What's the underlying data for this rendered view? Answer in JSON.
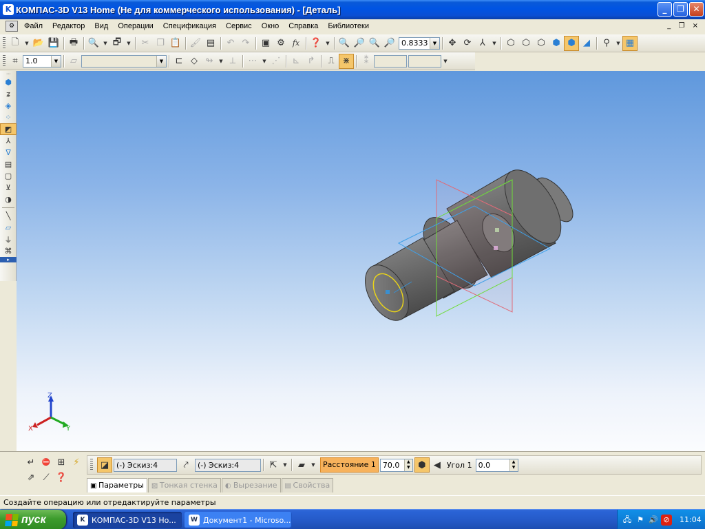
{
  "window": {
    "title": "КОМПАС-3D V13 Home (Не для коммерческого использования) - [Деталь]",
    "controls": [
      "_",
      "❐",
      "✕"
    ]
  },
  "menu": {
    "items": [
      "Файл",
      "Редактор",
      "Вид",
      "Операции",
      "Спецификация",
      "Сервис",
      "Окно",
      "Справка",
      "Библиотеки"
    ],
    "mdi_controls": "_ ❐ ×"
  },
  "toolbar": {
    "zoom_value": "0.8333",
    "step_value": "1.0"
  },
  "viewport": {
    "axes": {
      "z": "Z",
      "x": "X",
      "y": "Y"
    }
  },
  "params": {
    "sketch1": "(-) Эскиз:4",
    "sketch2": "(-) Эскиз:4",
    "distance_label": "Расстояние 1",
    "distance_value": "70.0",
    "angle_label": "Угол 1",
    "angle_value": "0.0"
  },
  "tabs": [
    {
      "label": "Параметры",
      "active": true
    },
    {
      "label": "Тонкая стенка",
      "active": false
    },
    {
      "label": "Вырезание",
      "active": false
    },
    {
      "label": "Свойства",
      "active": false
    }
  ],
  "status": {
    "text": "Создайте операцию или отредактируйте параметры"
  },
  "taskbar": {
    "start_label": "пуск",
    "buttons": [
      "КОМПАС-3D V13 Ho...",
      "Документ1 - Microso..."
    ],
    "clock": "11:04"
  },
  "icons": {
    "accent_orange": "#f5c66a",
    "title_blue": "#0054e3"
  }
}
